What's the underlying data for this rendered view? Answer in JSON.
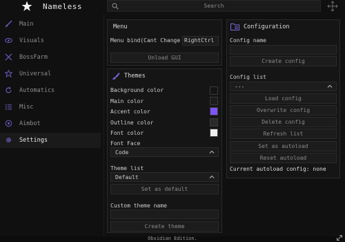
{
  "app": {
    "title": "Nameless",
    "footer": "Obsidian Edition."
  },
  "search": {
    "placeholder": "Search"
  },
  "sidebar": {
    "items": [
      {
        "label": "Main",
        "icon": "sword-icon"
      },
      {
        "label": "Visuals",
        "icon": "eye-icon"
      },
      {
        "label": "BossFarm",
        "icon": "crossed-swords-icon"
      },
      {
        "label": "Universal",
        "icon": "star-icon"
      },
      {
        "label": "Automatics",
        "icon": "refresh-icon"
      },
      {
        "label": "Misc",
        "icon": "list-icon"
      },
      {
        "label": "Aimbot",
        "icon": "target-icon"
      },
      {
        "label": "Settings",
        "icon": "gear-icon",
        "active": true
      }
    ]
  },
  "menu_panel": {
    "title": "Menu",
    "bind_label": "Menu bind(Cant Change",
    "bind_value": "RightCtrl",
    "unload_label": "Unload GUI"
  },
  "themes_panel": {
    "title": "Themes",
    "color_rows": [
      {
        "label": "Background color",
        "color": "#141414"
      },
      {
        "label": "Main color",
        "color": "#1c1c1c"
      },
      {
        "label": "Accent color",
        "color": "#7d55ff"
      },
      {
        "label": "Outline color",
        "color": "#2a2a2a"
      },
      {
        "label": "Font color",
        "color": "#f0f0f0"
      }
    ],
    "font_face_label": "Font Face",
    "font_face_value": "Code",
    "theme_list_label": "Theme list",
    "theme_list_value": "Default",
    "set_default_label": "Set as default",
    "custom_name_label": "Custom theme name",
    "create_theme_label": "Create theme"
  },
  "config_panel": {
    "title": "Configuration",
    "config_name_label": "Config name",
    "create_config_label": "Create config",
    "config_list_label": "Config list",
    "config_list_value": "---",
    "load_label": "Load config",
    "overwrite_label": "Overwrite config",
    "delete_label": "Delete config",
    "refresh_label": "Refresh list",
    "set_autoload_label": "Set as autoload",
    "reset_autoload_label": "Reset autoload",
    "current_autoload": "Current autoload config: none"
  }
}
